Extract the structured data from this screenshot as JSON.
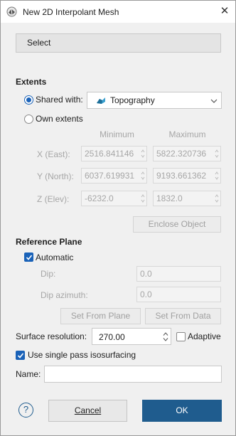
{
  "window": {
    "title": "New 2D Interpolant Mesh"
  },
  "select_button": {
    "label": "Select"
  },
  "extents": {
    "section_title": "Extents",
    "shared_with_label": "Shared with:",
    "shared_with_value": "Topography",
    "own_extents_label": "Own extents",
    "col_min": "Minimum",
    "col_max": "Maximum",
    "rows": [
      {
        "label": "X (East):",
        "min": "2516.841146",
        "max": "5822.320736"
      },
      {
        "label": "Y (North):",
        "min": "6037.619931",
        "max": "9193.661362"
      },
      {
        "label": "Z (Elev):",
        "min": "-6232.0",
        "max": "1832.0"
      }
    ],
    "enclose_button": "Enclose Object"
  },
  "reference_plane": {
    "section_title": "Reference Plane",
    "automatic_label": "Automatic",
    "dip_label": "Dip:",
    "dip_value": "0.0",
    "dip_azimuth_label": "Dip azimuth:",
    "dip_azimuth_value": "0.0",
    "set_from_plane": "Set From Plane",
    "set_from_data": "Set From Data"
  },
  "surface_resolution": {
    "label": "Surface resolution:",
    "value": "270.00",
    "adaptive_label": "Adaptive"
  },
  "single_pass_label": "Use single pass isosurfacing",
  "name": {
    "label": "Name:",
    "value": ""
  },
  "footer": {
    "help": "?",
    "cancel": "Cancel",
    "ok": "OK"
  },
  "colors": {
    "accent": "#1a62b8",
    "ok_button": "#1f5c8e"
  }
}
